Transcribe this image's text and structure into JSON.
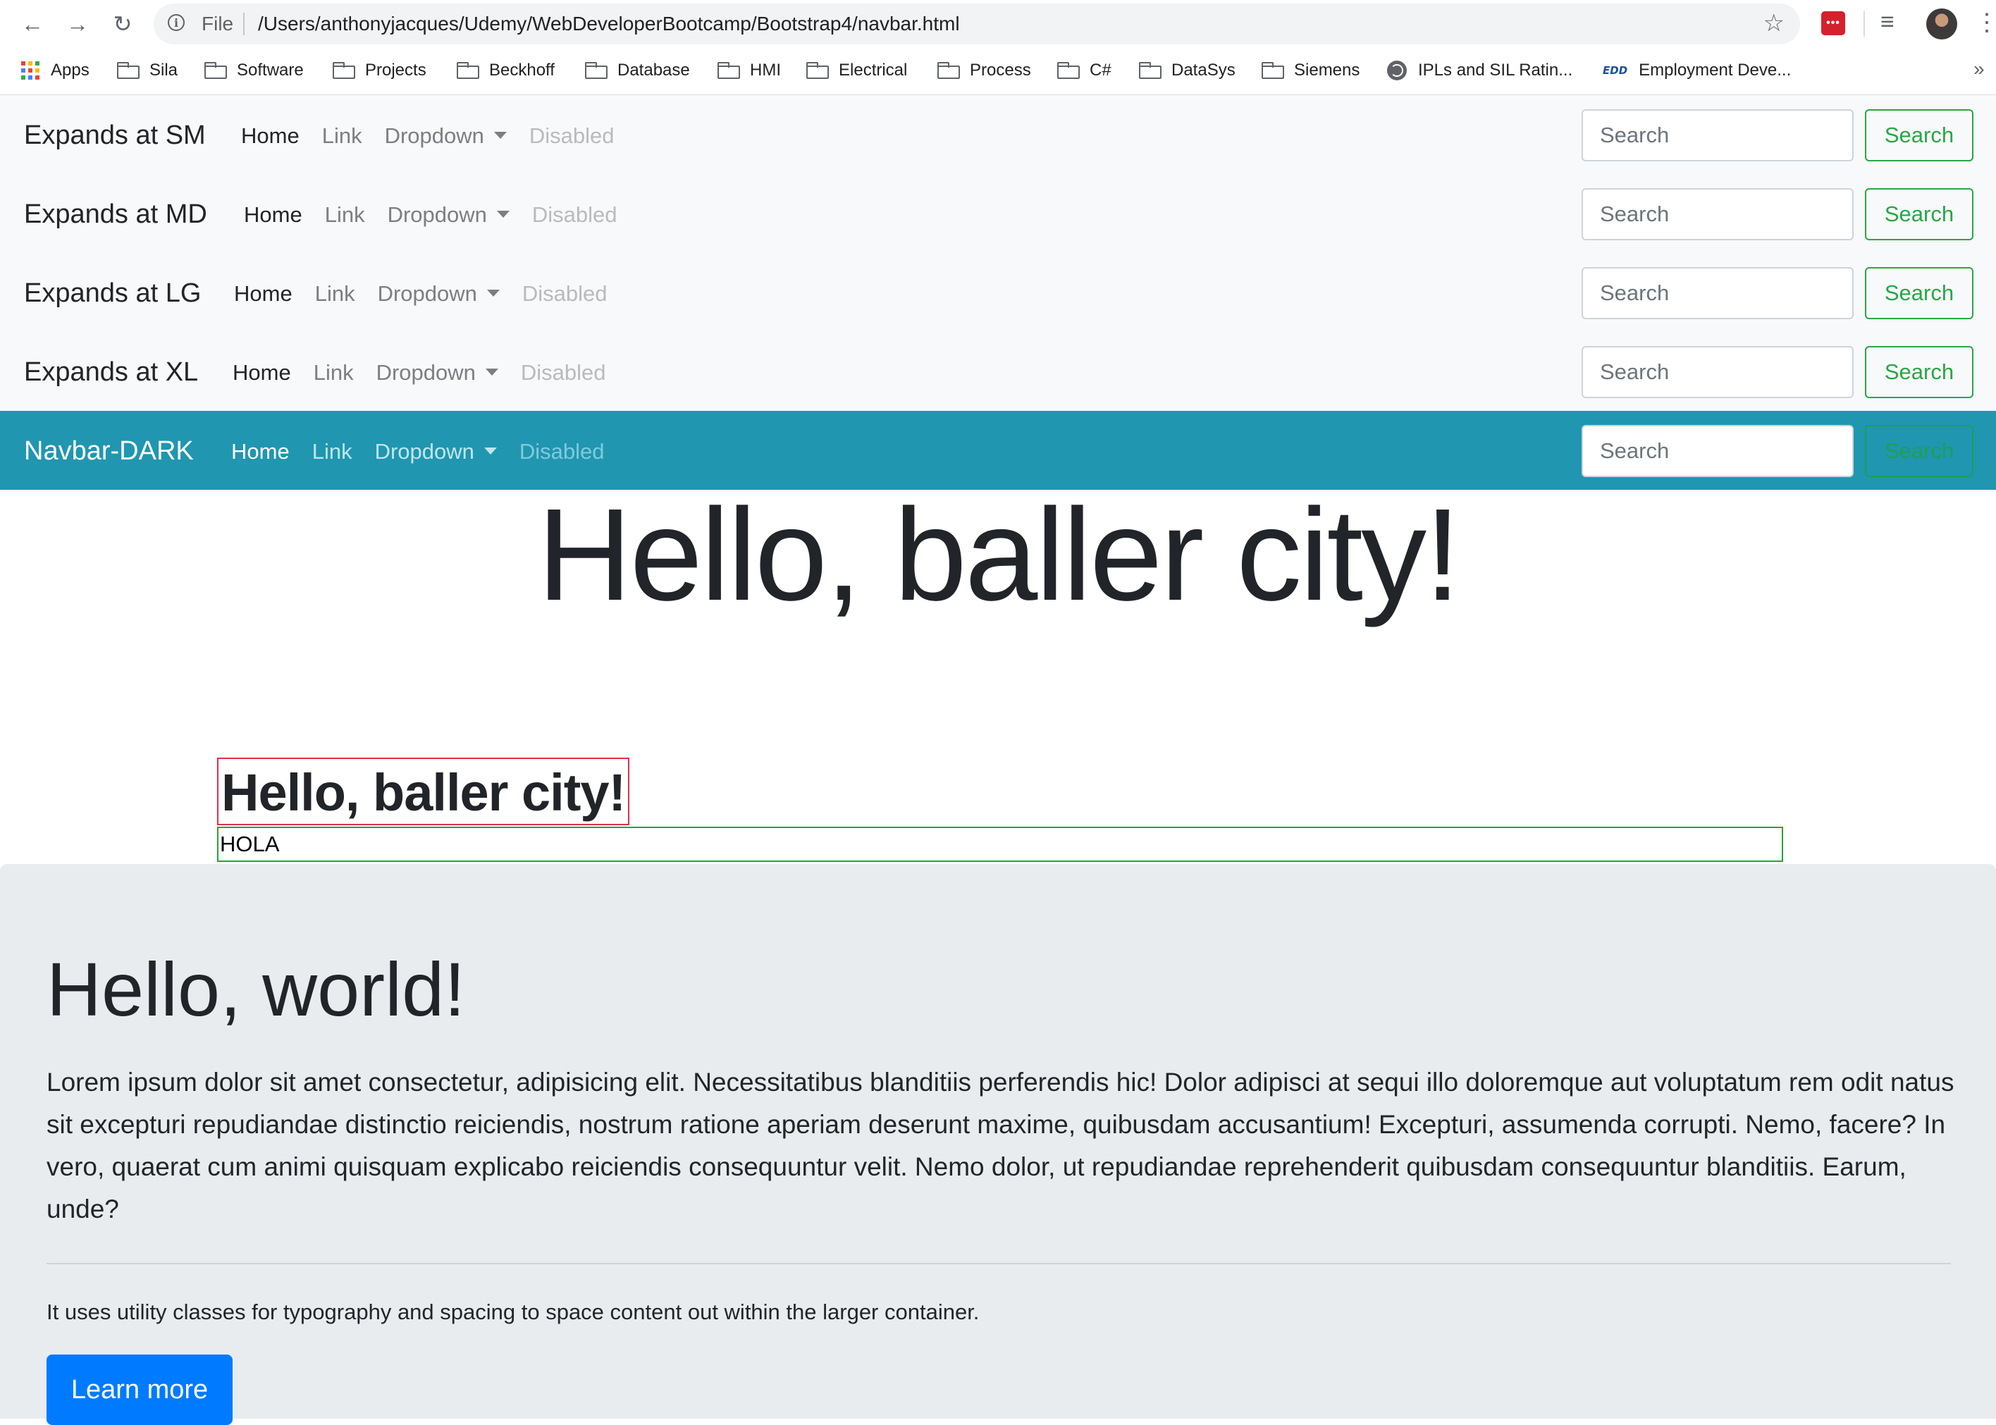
{
  "browser": {
    "url_scheme_label": "File",
    "url": "/Users/anthonyjacques/Udemy/WebDeveloperBootcamp/Bootstrap4/navbar.html",
    "extension_badge": "•••"
  },
  "bookmarks": [
    {
      "label": "Apps",
      "icon": "apps-grid-icon"
    },
    {
      "label": "Sila",
      "icon": "folder-icon"
    },
    {
      "label": "Software",
      "icon": "folder-icon"
    },
    {
      "label": "Projects",
      "icon": "folder-icon"
    },
    {
      "label": "Beckhoff",
      "icon": "folder-icon"
    },
    {
      "label": "Database",
      "icon": "folder-icon"
    },
    {
      "label": "HMI",
      "icon": "folder-icon"
    },
    {
      "label": "Electrical",
      "icon": "folder-icon"
    },
    {
      "label": "Process",
      "icon": "folder-icon"
    },
    {
      "label": "C#",
      "icon": "folder-icon"
    },
    {
      "label": "DataSys",
      "icon": "folder-icon"
    },
    {
      "label": "Siemens",
      "icon": "folder-icon"
    },
    {
      "label": "IPLs and SIL Ratin...",
      "icon": "globe-icon"
    },
    {
      "label": "Employment Deve...",
      "icon": "edd-icon",
      "icon_text": "EDD"
    }
  ],
  "navbars": [
    {
      "brand": "Expands at SM",
      "home": "Home",
      "link": "Link",
      "dropdown": "Dropdown",
      "disabled": "Disabled",
      "search_placeholder": "Search",
      "search_button": "Search"
    },
    {
      "brand": "Expands at MD",
      "home": "Home",
      "link": "Link",
      "dropdown": "Dropdown",
      "disabled": "Disabled",
      "search_placeholder": "Search",
      "search_button": "Search"
    },
    {
      "brand": "Expands at LG",
      "home": "Home",
      "link": "Link",
      "dropdown": "Dropdown",
      "disabled": "Disabled",
      "search_placeholder": "Search",
      "search_button": "Search"
    },
    {
      "brand": "Expands at XL",
      "home": "Home",
      "link": "Link",
      "dropdown": "Dropdown",
      "disabled": "Disabled",
      "search_placeholder": "Search",
      "search_button": "Search"
    },
    {
      "brand": "Navbar-DARK",
      "home": "Home",
      "link": "Link",
      "dropdown": "Dropdown",
      "disabled": "Disabled",
      "search_placeholder": "Search",
      "search_button": "Search"
    }
  ],
  "content": {
    "display_heading": "Hello, baller city!",
    "boxed_heading": "Hello, baller city!",
    "hola_text": "HOLA"
  },
  "jumbotron": {
    "title": "Hello, world!",
    "lead": "Lorem ipsum dolor sit amet consectetur, adipisicing elit. Necessitatibus blanditiis perferendis hic! Dolor adipisci at sequi illo doloremque aut voluptatum rem odit natus sit excepturi repudiandae distinctio reiciendis, nostrum ratione aperiam deserunt maxime, quibusdam accusantium! Excepturi, assumenda corrupti. Nemo, facere? In vero, quaerat cum animi quisquam explicabo reiciendis consequuntur velit. Nemo dolor, ut repudiandae reprehenderit quibusdam consequuntur blanditiis. Earum, unde?",
    "utility_text": "It uses utility classes for typography and spacing to space content out within the larger container.",
    "button_label": "Learn more"
  },
  "colors": {
    "navbar_light_bg": "#f8f9fa",
    "navbar_dark_bg": "#2096b0",
    "success_green": "#28a745",
    "primary_blue": "#007bff",
    "jumbotron_bg": "#e9ecef",
    "outline_red": "#e0304a"
  }
}
